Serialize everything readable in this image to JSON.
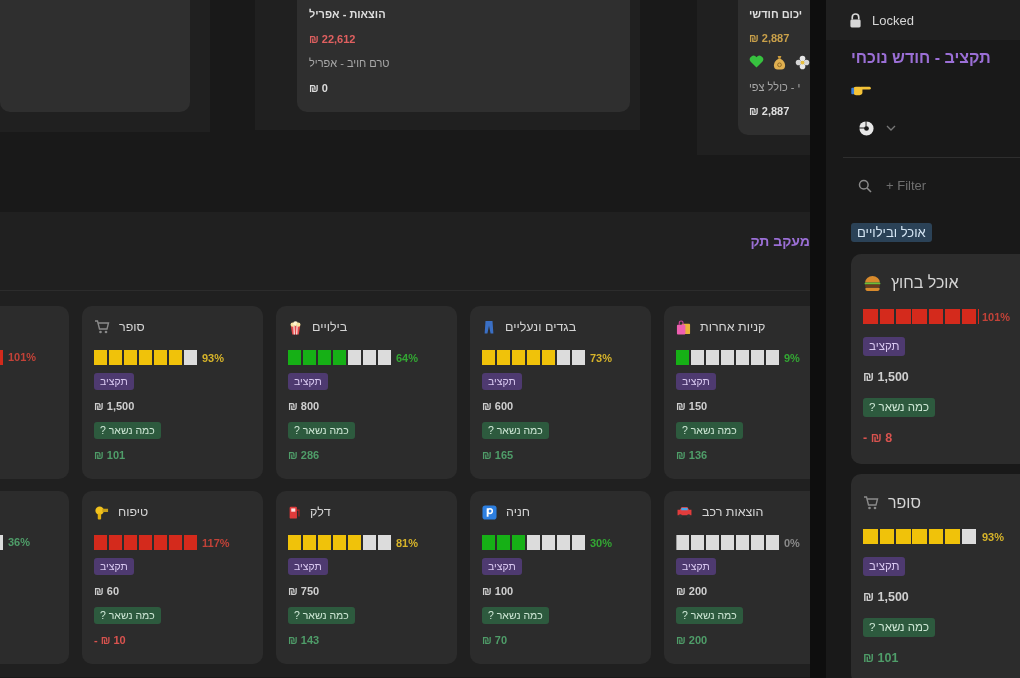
{
  "summary": {
    "expenses": {
      "title": "הוצאות - אפריל",
      "amount": "₪ 22,612",
      "pending_label": "טרם חויב - אפריל",
      "pending_amount": "₪ 0"
    },
    "monthly": {
      "title": "יכום חודשי",
      "amount": "₪ 2,887",
      "subtitle": "י - כולל צפי",
      "subtitle_amount": "₪ 2,887"
    }
  },
  "tracker": {
    "title": "מעקב תק",
    "rows": [
      {
        "cards": [
          {
            "kind": "full",
            "title": "קניות אחרות",
            "level": 0.143,
            "color": "#16b016",
            "percent": "9%",
            "budget_tag": "תקציב",
            "budget": "₪ 150",
            "remaining_tag": "כמה נשאר ?",
            "remaining": {
              "text": "₪ 136",
              "color": "#4f9d69"
            }
          },
          {
            "kind": "full",
            "title": "בגדים ונעליים",
            "level": 0.714,
            "color": "#f0c20a",
            "percent": "73%",
            "budget_tag": "תקציב",
            "budget": "₪ 600",
            "remaining_tag": "כמה נשאר ?",
            "remaining": {
              "text": "₪ 165",
              "color": "#4f9d69"
            }
          },
          {
            "kind": "full",
            "title": "בילויים",
            "level": 0.571,
            "color": "#16b016",
            "percent": "64%",
            "budget_tag": "תקציב",
            "budget": "₪ 800",
            "remaining_tag": "כמה נשאר ?",
            "remaining": {
              "text": "₪ 286",
              "color": "#4f9d69"
            }
          },
          {
            "kind": "full",
            "title": "סופר",
            "level": 0.857,
            "color": "#f0c20a",
            "percent": "93%",
            "budget_tag": "תקציב",
            "budget": "₪ 1,500",
            "remaining_tag": "כמה נשאר ?",
            "remaining": {
              "text": "₪ 101",
              "color": "#4f9d69"
            }
          },
          {
            "kind": "cut",
            "level": 1,
            "color": "#d42a1c",
            "percent": "101%"
          }
        ]
      },
      {
        "cards": [
          {
            "kind": "full",
            "title": "הוצאות רכב",
            "level": 0,
            "color": "#8a8a8a",
            "percent": "0%",
            "budget_tag": "תקציב",
            "budget": "₪ 200",
            "remaining_tag": "כמה נשאר ?",
            "remaining": {
              "text": "₪ 200",
              "color": "#4f9d69"
            }
          },
          {
            "kind": "full",
            "title": "חניה",
            "level": 0.429,
            "color": "#16b016",
            "percent": "30%",
            "budget_tag": "תקציב",
            "budget": "₪ 100",
            "remaining_tag": "כמה נשאר ?",
            "remaining": {
              "text": "₪ 70",
              "color": "#4f9d69"
            }
          },
          {
            "kind": "full",
            "title": "דלק",
            "level": 0.714,
            "color": "#f0c20a",
            "percent": "81%",
            "budget_tag": "תקציב",
            "budget": "₪ 750",
            "remaining_tag": "כמה נשאר ?",
            "remaining": {
              "text": "₪ 143",
              "color": "#4f9d69"
            }
          },
          {
            "kind": "full",
            "title": "טיפוח",
            "level": 1,
            "color": "#d42a1c",
            "percent": "117%",
            "budget_tag": "תקציב",
            "budget": "₪ 60",
            "remaining_tag": "כמה נשאר ?",
            "remaining": {
              "text": "- ₪ 10",
              "color": "#d9534f"
            }
          },
          {
            "kind": "cut",
            "color": "#4f9d69",
            "percent": "36%"
          }
        ]
      }
    ]
  },
  "side_panel": {
    "lock_label": "Locked",
    "title": "תקציב - חודש נוכחי",
    "filter_label": "+ Filter",
    "group": "אוכל ובילויים",
    "cards": [
      {
        "kind": "full",
        "title": "אוכל בחוץ",
        "level": 1,
        "color": "#d42a1c",
        "percent": "101%",
        "budget_tag": "תקציב",
        "budget": "₪ 1,500",
        "remaining_tag": "כמה נשאר ?",
        "remaining": {
          "text": "- ₪ 8",
          "color": "#d9534f"
        }
      },
      {
        "kind": "full",
        "title": "סופר",
        "level": 0.857,
        "color": "#f0c20a",
        "percent": "93%",
        "budget_tag": "תקציב",
        "budget": "₪ 1,500",
        "remaining_tag": "כמה נשאר ?",
        "remaining": {
          "text": "₪ 101",
          "color": "#4f9d69"
        }
      }
    ]
  }
}
